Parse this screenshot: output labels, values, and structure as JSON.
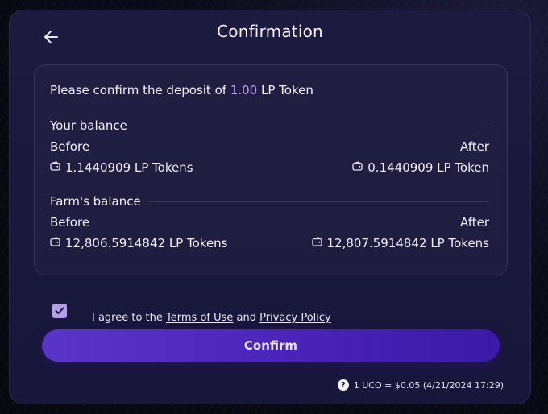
{
  "dialog": {
    "title": "Confirmation",
    "back_icon": "arrow-left-icon"
  },
  "confirm_text": {
    "prefix": "Please confirm the deposit of",
    "amount": "1.00",
    "token": "LP Token"
  },
  "your_balance": {
    "label": "Your balance",
    "before_label": "Before",
    "after_label": "After",
    "before_value": "1.1440909 LP Tokens",
    "after_value": "0.1440909 LP Token"
  },
  "farm_balance": {
    "label": "Farm's balance",
    "before_label": "Before",
    "after_label": "After",
    "before_value": "12,806.5914842 LP Tokens",
    "after_value": "12,807.5914842 LP Tokens"
  },
  "agreement": {
    "checked": true,
    "prefix": "I agree to the",
    "terms": "Terms of Use",
    "and": "and",
    "privacy": "Privacy Policy"
  },
  "confirm_button": {
    "label": "Confirm"
  },
  "price_info": {
    "text": "1 UCO = $0.05 (4/21/2024 17:29)",
    "icon": "?"
  },
  "colors": {
    "accent": "#b79cf1",
    "button_start": "#5b35c9",
    "button_end": "#3a1aa6",
    "modal_bg": "#1d1a3f"
  }
}
